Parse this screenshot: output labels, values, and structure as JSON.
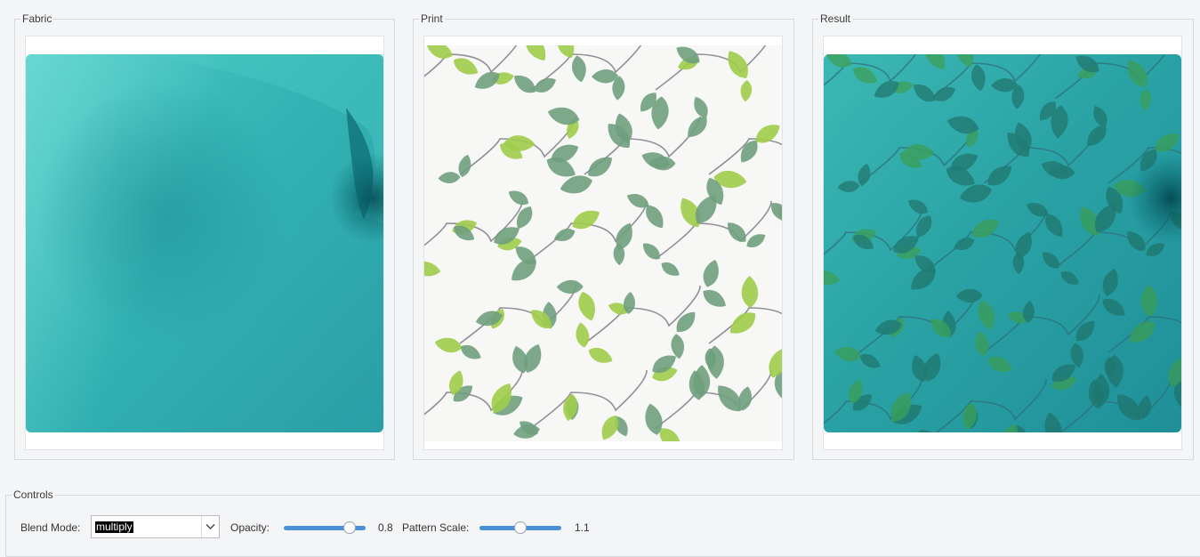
{
  "panels": {
    "fabric": {
      "title": "Fabric"
    },
    "print": {
      "title": "Print"
    },
    "result": {
      "title": "Result"
    }
  },
  "controls": {
    "title": "Controls",
    "blend_mode": {
      "label": "Blend Mode:",
      "value": "multiply"
    },
    "opacity": {
      "label": "Opacity:",
      "value": "0.8",
      "fraction": 0.8
    },
    "pattern_scale": {
      "label": "Pattern Scale:",
      "value": "1.1",
      "fraction": 0.5
    }
  },
  "colors": {
    "fabric": "#2fb0b2",
    "leaf_dark": "#6f9e7e",
    "leaf_light": "#9fcc4a",
    "stem": "#8f8f9a",
    "slider_accent": "#4a90d9"
  }
}
